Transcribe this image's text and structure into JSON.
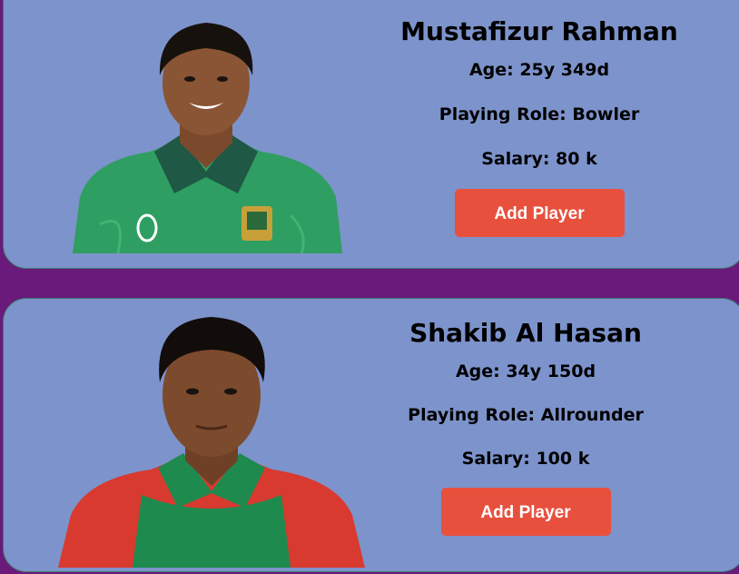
{
  "players": [
    {
      "name": "Mustafizur Rahman",
      "age": "Age: 25y 349d",
      "role": "Playing Role: Bowler",
      "salary": "Salary: 80 k",
      "button_label": "Add Player",
      "jersey_color": "#2e9f63"
    },
    {
      "name": "Shakib Al Hasan",
      "age": "Age: 34y 150d",
      "role": "Playing Role: Allrounder",
      "salary": "Salary: 100 k",
      "button_label": "Add Player",
      "jersey_color": "#d83a2f"
    }
  ],
  "colors": {
    "page_background": "#6a1a7a",
    "card_background": "#7d93cb",
    "button": "#e8503e"
  }
}
